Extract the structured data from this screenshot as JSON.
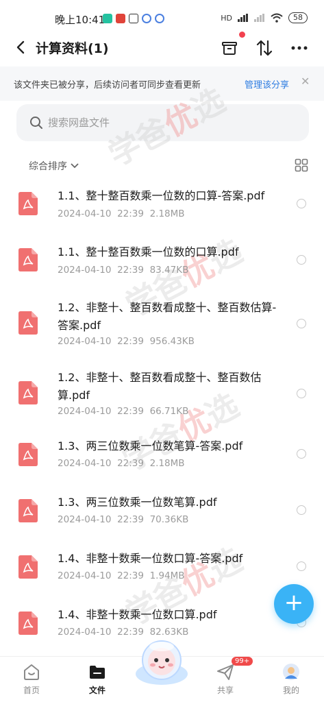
{
  "status_bar": {
    "time": "晚上10:41",
    "network": "HD",
    "battery": "58"
  },
  "header": {
    "title": "计算资料(1)"
  },
  "notice": {
    "text": "该文件夹已被分享，后续访问者可同步查看更新",
    "action": "管理该分享"
  },
  "search": {
    "placeholder": "搜索网盘文件"
  },
  "sort": {
    "label": "综合排序"
  },
  "watermark": {
    "text_a": "学爸",
    "text_b": "优",
    "text_c": "选"
  },
  "files": [
    {
      "name": "1.1、整十整百数乘一位数的口算-答案.pdf",
      "date": "2024-04-10",
      "time": "22:39",
      "size": "2.18MB"
    },
    {
      "name": "1.1、整十整百数乘一位数的口算.pdf",
      "date": "2024-04-10",
      "time": "22:39",
      "size": "83.47KB"
    },
    {
      "name": "1.2、非整十、整百数看成整十、整百数估算-答案.pdf",
      "date": "2024-04-10",
      "time": "22:39",
      "size": "956.43KB"
    },
    {
      "name": "1.2、非整十、整百数看成整十、整百数估算.pdf",
      "date": "2024-04-10",
      "time": "22:39",
      "size": "66.71KB"
    },
    {
      "name": "1.3、两三位数乘一位数笔算-答案.pdf",
      "date": "2024-04-10",
      "time": "22:39",
      "size": "2.18MB"
    },
    {
      "name": "1.3、两三位数乘一位数笔算.pdf",
      "date": "2024-04-10",
      "time": "22:39",
      "size": "70.36KB"
    },
    {
      "name": "1.4、非整十数乘一位数口算-答案.pdf",
      "date": "2024-04-10",
      "time": "22:39",
      "size": "1.94MB"
    },
    {
      "name": "1.4、非整十数乘一位数口算.pdf",
      "date": "2024-04-10",
      "time": "22:39",
      "size": "82.63KB"
    }
  ],
  "nav": {
    "home": "首页",
    "files": "文件",
    "share": "共享",
    "share_badge": "99+",
    "me": "我的"
  },
  "colors": {
    "accent": "#2f7de1",
    "fab": "#3ab3f6",
    "pdf_icon": "#f07070",
    "badge": "#f04a4a"
  }
}
